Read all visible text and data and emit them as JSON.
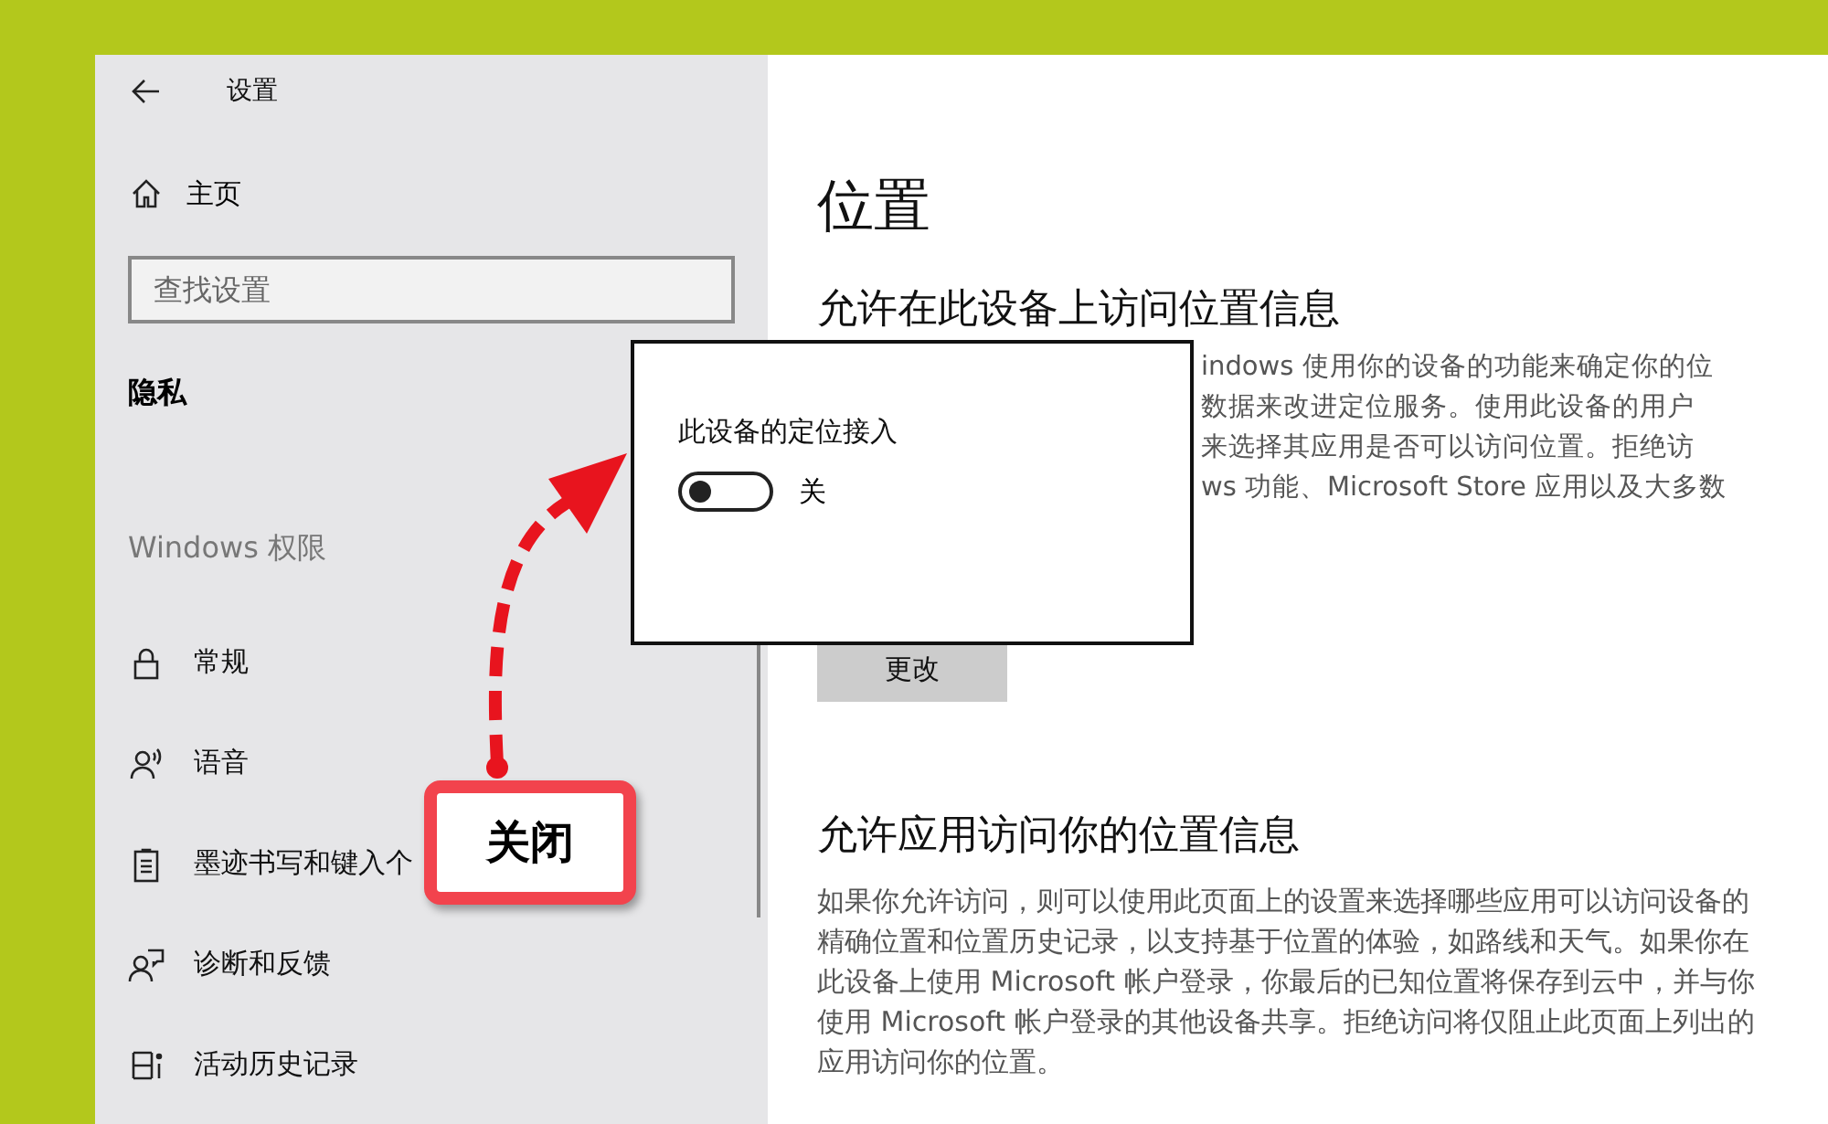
{
  "window": {
    "title": "设置"
  },
  "sidebar": {
    "home": "主页",
    "search": {
      "placeholder": "查找设置"
    },
    "section": "隐私",
    "group": "Windows 权限",
    "items": [
      {
        "kind": "lock",
        "label": "常规"
      },
      {
        "kind": "speech",
        "label": "语音"
      },
      {
        "kind": "notepad",
        "label": "墨迹书写和键入个"
      },
      {
        "kind": "feedback",
        "label": "诊断和反馈"
      },
      {
        "kind": "timeline",
        "label": "活动历史记录"
      }
    ]
  },
  "main": {
    "title": "位置",
    "section_1": {
      "heading": "允许在此设备上访问位置信息",
      "description_lines": [
        "indows 使用你的设备的功能来确定你的位",
        "数据来改进定位服务。使用此设备的用户",
        "来选择其应用是否可以访问位置。拒绝访",
        "ws 功能、Microsoft Store 应用以及大多数"
      ],
      "button": "更改"
    },
    "section_2": {
      "heading": "允许应用访问你的位置信息",
      "description": "如果你允许访问，则可以使用此页面上的设置来选择哪些应用可以访问设备的精确位置和位置历史记录，以支持基于位置的体验，如路线和天气。如果你在此设备上使用 Microsoft 帐户登录，你最后的已知位置将保存到云中，并与你使用 Microsoft 帐户登录的其他设备共享。拒绝访问将仅阻止此页面上列出的应用访问你的位置。"
    }
  },
  "popup": {
    "label": "此设备的定位接入",
    "toggle": {
      "on": false,
      "state_text": "关"
    }
  },
  "callout": {
    "text": "关闭"
  }
}
